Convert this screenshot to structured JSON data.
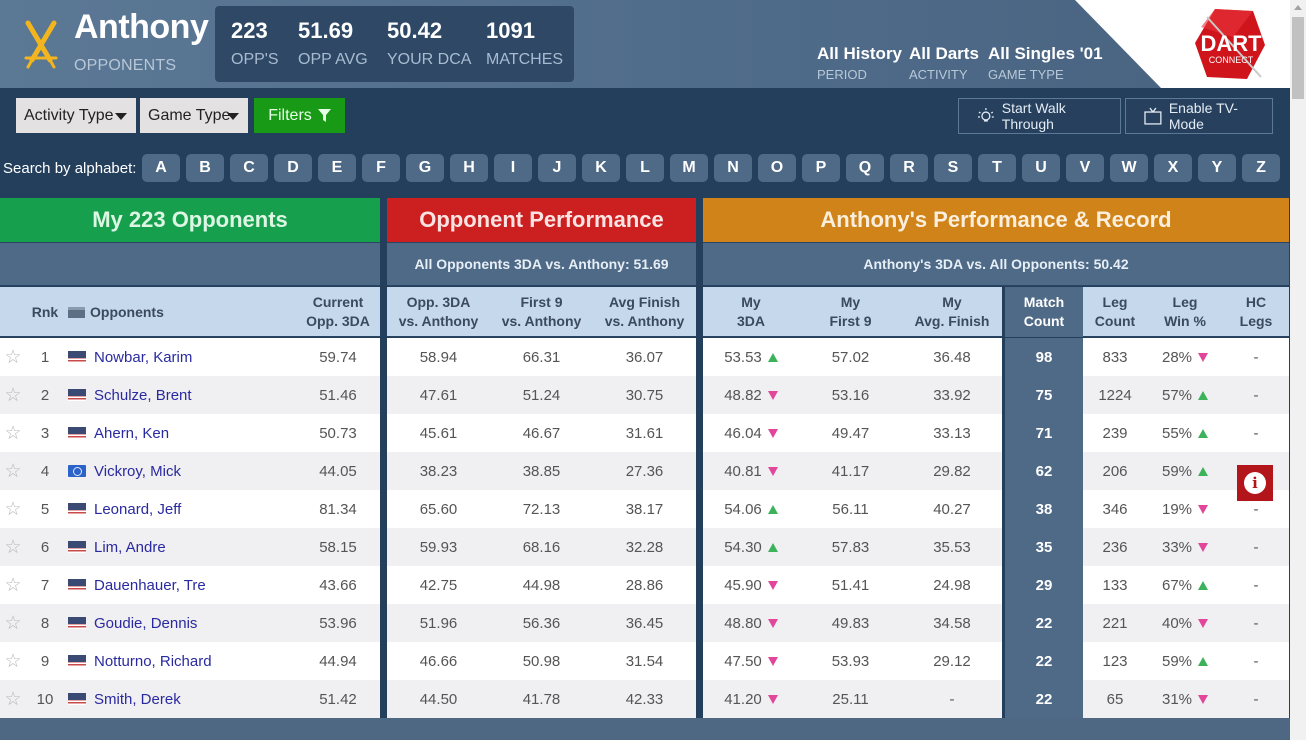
{
  "header": {
    "player_name": "Anthony",
    "subtitle": "OPPONENTS",
    "stats": [
      {
        "value": "223",
        "label": "OPP'S"
      },
      {
        "value": "51.69",
        "label": "OPP AVG"
      },
      {
        "value": "50.42",
        "label": "YOUR DCA"
      },
      {
        "value": "1091",
        "label": "MATCHES"
      }
    ],
    "filters": [
      {
        "value": "All History",
        "label": "PERIOD"
      },
      {
        "value": "All Darts",
        "label": "ACTIVITY"
      },
      {
        "value": "All Singles '01",
        "label": "GAME TYPE"
      }
    ],
    "logo_text_top": "DART",
    "logo_text_bottom": "CONNECT"
  },
  "toolbar": {
    "activity_type": "Activity Type",
    "game_type": "Game Type",
    "filters": "Filters",
    "walk_through": "Start Walk Through",
    "tv_mode": "Enable TV-Mode",
    "alpha_label": "Search by alphabet:",
    "letters": [
      "A",
      "B",
      "C",
      "D",
      "E",
      "F",
      "G",
      "H",
      "I",
      "J",
      "K",
      "L",
      "M",
      "N",
      "O",
      "P",
      "Q",
      "R",
      "S",
      "T",
      "U",
      "V",
      "W",
      "X",
      "Y",
      "Z"
    ]
  },
  "sections": {
    "opponents": {
      "title": "My 223 Opponents",
      "color": "#16a04e"
    },
    "opp_perf": {
      "title": "Opponent Performance",
      "subtitle": "All Opponents 3DA vs. Anthony: 51.69",
      "color": "#cc1f1f"
    },
    "my_perf": {
      "title": "Anthony's Performance & Record",
      "subtitle": "Anthony's 3DA vs. All Opponents: 50.42",
      "color": "#cf8318"
    }
  },
  "columns": {
    "rank": "Rnk",
    "opponents": "Opponents",
    "current_3da": [
      "Current",
      "Opp. 3DA"
    ],
    "opp_3da": [
      "Opp. 3DA",
      "vs. Anthony"
    ],
    "first9": [
      "First 9",
      "vs. Anthony"
    ],
    "avg_finish": [
      "Avg Finish",
      "vs. Anthony"
    ],
    "my_3da": [
      "My",
      "3DA"
    ],
    "my_first9": [
      "My",
      "First 9"
    ],
    "my_avg_finish": [
      "My",
      "Avg. Finish"
    ],
    "match_count": [
      "Match",
      "Count"
    ],
    "leg_count": [
      "Leg",
      "Count"
    ],
    "leg_win": [
      "Leg",
      "Win %"
    ],
    "hc_legs": [
      "HC",
      "Legs"
    ]
  },
  "rows": [
    {
      "rank": "1",
      "flag": "us",
      "name": "Nowbar, Karim",
      "current": "59.74",
      "opp3da": "58.94",
      "first9": "66.31",
      "avgfin": "36.07",
      "my3da": "53.53",
      "my3da_trend": "up",
      "myfirst9": "57.02",
      "myavgfin": "36.48",
      "matches": "98",
      "legs": "833",
      "legwin": "28%",
      "legwin_trend": "down",
      "hc": "-"
    },
    {
      "rank": "2",
      "flag": "us",
      "name": "Schulze, Brent",
      "current": "51.46",
      "opp3da": "47.61",
      "first9": "51.24",
      "avgfin": "30.75",
      "my3da": "48.82",
      "my3da_trend": "down",
      "myfirst9": "53.16",
      "myavgfin": "33.92",
      "matches": "75",
      "legs": "1224",
      "legwin": "57%",
      "legwin_trend": "up",
      "hc": "-"
    },
    {
      "rank": "3",
      "flag": "us",
      "name": "Ahern, Ken",
      "current": "50.73",
      "opp3da": "45.61",
      "first9": "46.67",
      "avgfin": "31.61",
      "my3da": "46.04",
      "my3da_trend": "down",
      "myfirst9": "49.47",
      "myavgfin": "33.13",
      "matches": "71",
      "legs": "239",
      "legwin": "55%",
      "legwin_trend": "up",
      "hc": "-"
    },
    {
      "rank": "4",
      "flag": "world",
      "name": "Vickroy, Mick",
      "current": "44.05",
      "opp3da": "38.23",
      "first9": "38.85",
      "avgfin": "27.36",
      "my3da": "40.81",
      "my3da_trend": "down",
      "myfirst9": "41.17",
      "myavgfin": "29.82",
      "matches": "62",
      "legs": "206",
      "legwin": "59%",
      "legwin_trend": "up",
      "hc": "-"
    },
    {
      "rank": "5",
      "flag": "us",
      "name": "Leonard, Jeff",
      "current": "81.34",
      "opp3da": "65.60",
      "first9": "72.13",
      "avgfin": "38.17",
      "my3da": "54.06",
      "my3da_trend": "up",
      "myfirst9": "56.11",
      "myavgfin": "40.27",
      "matches": "38",
      "legs": "346",
      "legwin": "19%",
      "legwin_trend": "down",
      "hc": "-"
    },
    {
      "rank": "6",
      "flag": "us",
      "name": "Lim, Andre",
      "current": "58.15",
      "opp3da": "59.93",
      "first9": "68.16",
      "avgfin": "32.28",
      "my3da": "54.30",
      "my3da_trend": "up",
      "myfirst9": "57.83",
      "myavgfin": "35.53",
      "matches": "35",
      "legs": "236",
      "legwin": "33%",
      "legwin_trend": "down",
      "hc": "-"
    },
    {
      "rank": "7",
      "flag": "us",
      "name": "Dauenhauer, Tre",
      "current": "43.66",
      "opp3da": "42.75",
      "first9": "44.98",
      "avgfin": "28.86",
      "my3da": "45.90",
      "my3da_trend": "down",
      "myfirst9": "51.41",
      "myavgfin": "24.98",
      "matches": "29",
      "legs": "133",
      "legwin": "67%",
      "legwin_trend": "up",
      "hc": "-"
    },
    {
      "rank": "8",
      "flag": "us",
      "name": "Goudie, Dennis",
      "current": "53.96",
      "opp3da": "51.96",
      "first9": "56.36",
      "avgfin": "36.45",
      "my3da": "48.80",
      "my3da_trend": "down",
      "myfirst9": "49.83",
      "myavgfin": "34.58",
      "matches": "22",
      "legs": "221",
      "legwin": "40%",
      "legwin_trend": "down",
      "hc": "-"
    },
    {
      "rank": "9",
      "flag": "us",
      "name": "Notturno, Richard",
      "current": "44.94",
      "opp3da": "46.66",
      "first9": "50.98",
      "avgfin": "31.54",
      "my3da": "47.50",
      "my3da_trend": "down",
      "myfirst9": "53.93",
      "myavgfin": "29.12",
      "matches": "22",
      "legs": "123",
      "legwin": "59%",
      "legwin_trend": "up",
      "hc": "-"
    },
    {
      "rank": "10",
      "flag": "us",
      "name": "Smith, Derek",
      "current": "51.42",
      "opp3da": "44.50",
      "first9": "41.78",
      "avgfin": "42.33",
      "my3da": "41.20",
      "my3da_trend": "down",
      "myfirst9": "25.11",
      "myavgfin": "-",
      "matches": "22",
      "legs": "65",
      "legwin": "31%",
      "legwin_trend": "down",
      "hc": "-"
    }
  ],
  "info_button": "i"
}
